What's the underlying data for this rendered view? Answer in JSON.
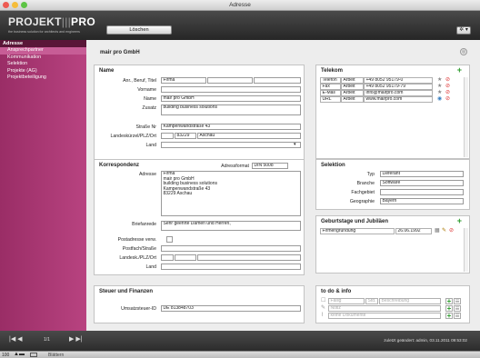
{
  "window": {
    "title": "Adresse"
  },
  "header": {
    "logo_main": "PROJEKT",
    "logo_sep": "|||",
    "logo_pro": "PRO",
    "tagline": "the business solution for architects and engineers",
    "delete_label": "Löschen",
    "gear_label": "✲ ▾"
  },
  "sidebar": {
    "heading": "Adresse",
    "items": [
      {
        "label": "Ansprechpartner",
        "selected": true
      },
      {
        "label": "Kommunikation",
        "selected": false
      },
      {
        "label": "Selektion",
        "selected": false
      },
      {
        "label": "Projekte (AG)",
        "selected": false
      },
      {
        "label": "Projektbeteiligung",
        "selected": false
      }
    ]
  },
  "record": {
    "title": "mair pro GmbH"
  },
  "name_panel": {
    "heading": "Name",
    "labels": {
      "anrede": "Anr., Beruf, Titel",
      "vorname": "Vorname",
      "name": "Name",
      "zusatz": "Zusatz",
      "strasse": "Straße Nr",
      "landeskz": "Landeskürzel/PLZ/Ort",
      "land": "Land"
    },
    "values": {
      "anrede": "Firma",
      "vorname": "",
      "name": "mair pro GmbH",
      "zusatz": "building business solutions",
      "strasse": "Kampenwandstraße 43",
      "plz": "83229",
      "ort": "Aschau",
      "land": ""
    }
  },
  "korrespondenz": {
    "heading": "Korrespondenz",
    "adressformat_label": "Adressformat",
    "adressformat_value": "DIN 5008",
    "adresse_label": "Adresse",
    "adresse_value": "Firma\nmair pro GmbH\nbuilding business solutions\nKampenwandstraße 43\n83229 Aschau",
    "briefanrede_label": "Briefanrede",
    "briefanrede_value": "Sehr geehrte Damen und Herren,",
    "postadresse_label": "Postadresse verw.",
    "postfach_label": "Postfach/Straße",
    "landesk_label": "Landesk./PLZ/Ort",
    "land_label": "Land"
  },
  "steuer": {
    "heading": "Steuer und Finanzen",
    "ust_label": "Umsatzsteuer-ID",
    "ust_value": "DE 813848703"
  },
  "telekom": {
    "heading": "Telekom",
    "rows": [
      {
        "type": "Telefon",
        "cat": "Arbeit",
        "value": "+49 8052 95179-0"
      },
      {
        "type": "Fax",
        "cat": "Arbeit",
        "value": "+49 8052 95179-79"
      },
      {
        "type": "E-Mail",
        "cat": "Arbeit",
        "value": "info@mairpro.com"
      },
      {
        "type": "URL",
        "cat": "Arbeit",
        "value": "www.mairpro.com"
      }
    ]
  },
  "selektion": {
    "heading": "Selektion",
    "labels": {
      "typ": "Typ",
      "branche": "Branche",
      "fachgebiet": "Fachgebiet",
      "geographie": "Geographie"
    },
    "values": {
      "typ": "Lieferant",
      "branche": "Software",
      "fachgebiet": "",
      "geographie": "Bayern"
    }
  },
  "geburtstage": {
    "heading": "Geburtstage und Jubiläen",
    "rows": [
      {
        "label": "Firmengründung",
        "date": "26.06.1992"
      }
    ]
  },
  "todo": {
    "heading": "to do & info",
    "placeholders": [
      "Fällig",
      "Std.",
      "Beschreibung",
      "Notiz",
      "keine Dokumente"
    ]
  },
  "bottom": {
    "nav_first": "|◀ ◀",
    "record_counter": "1/1",
    "nav_last": "▶ ▶|",
    "saved": "zuletzt geändert: admin, 03.11.2011 09:53:02"
  },
  "status": {
    "zoom": "100",
    "mode": "Blättern"
  },
  "colors": {
    "sidebar": "#b84380",
    "sidebar_heading": "#5a1638",
    "header": "#2c2c2c",
    "accent_plus": "#2a9a2a"
  }
}
